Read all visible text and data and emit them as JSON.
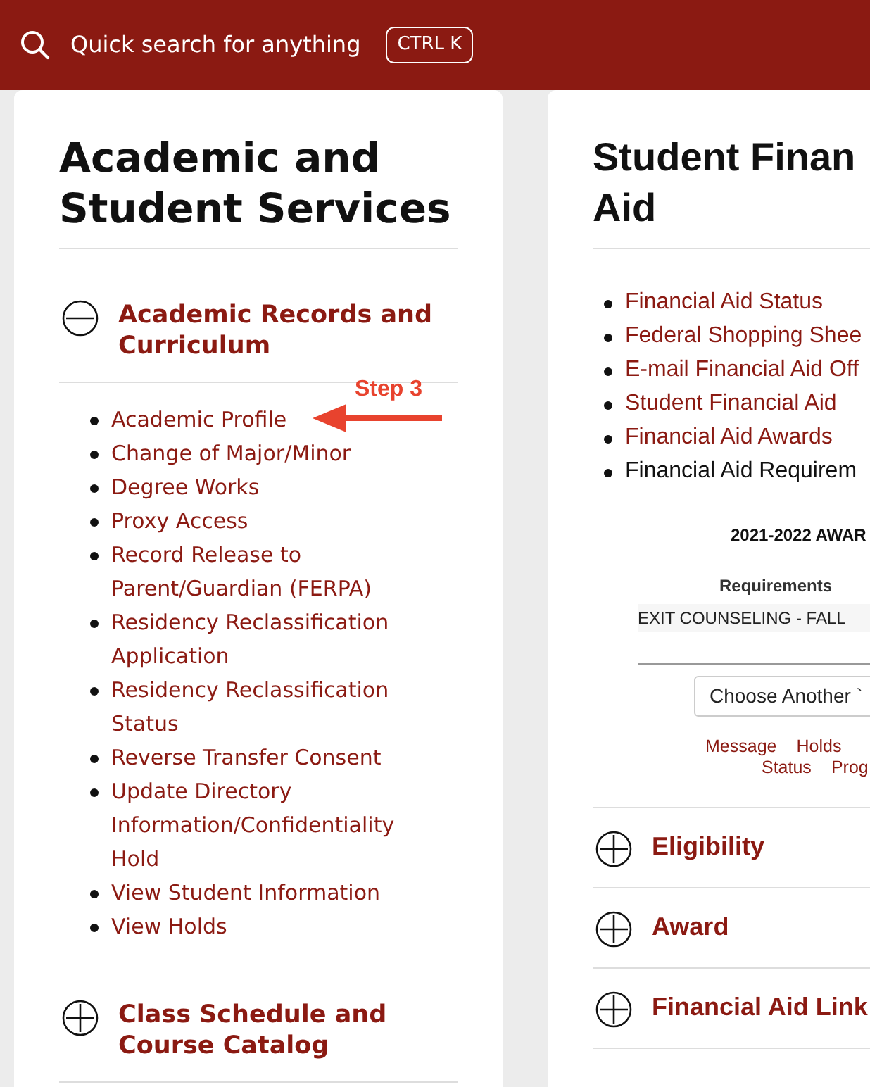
{
  "header": {
    "search_label": "Quick search for anything",
    "shortcut": "CTRL K"
  },
  "cards": [
    {
      "title_lines": [
        "Academic and",
        "Student Services"
      ],
      "sections": [
        {
          "title": "Academic Records and Curriculum",
          "expanded": true,
          "items": [
            "Academic Profile",
            "Change of Major/Minor",
            "Degree Works",
            "Proxy Access",
            "Record Release to Parent/Guardian (FERPA)",
            "Residency Reclassification Application",
            "Residency Reclassification Status",
            "Reverse Transfer Consent",
            "Update Directory Information/Confidentiality Hold",
            "View Student Information",
            "View Holds"
          ]
        },
        {
          "title": "Class Schedule and Course Catalog",
          "expanded": false
        }
      ]
    },
    {
      "title_lines": [
        "Student Finan",
        "Aid"
      ],
      "links": [
        {
          "text": "Financial Aid Status",
          "kind": "link"
        },
        {
          "text": "Federal Shopping Shee",
          "kind": "link"
        },
        {
          "text": "E-mail Financial Aid Off",
          "kind": "link"
        },
        {
          "text": "Student Financial Aid",
          "kind": "link"
        },
        {
          "text": "Financial Aid Awards",
          "kind": "link"
        },
        {
          "text": "Financial Aid Requirem",
          "kind": "current"
        }
      ],
      "award": {
        "year": "2021-2022 AWAR",
        "label": "Requirements",
        "requirement": "EXIT COUNSELING - FALL",
        "select": "Choose Another `",
        "links_row_1": [
          "Message",
          "Holds"
        ],
        "links_row_2": [
          "Status",
          "Prog"
        ]
      },
      "sections": [
        {
          "title": "Eligibility",
          "expanded": false
        },
        {
          "title": "Award",
          "expanded": false
        },
        {
          "title": "Financial Aid Link",
          "expanded": false
        }
      ]
    }
  ],
  "annotation": {
    "text": "Step 3"
  }
}
